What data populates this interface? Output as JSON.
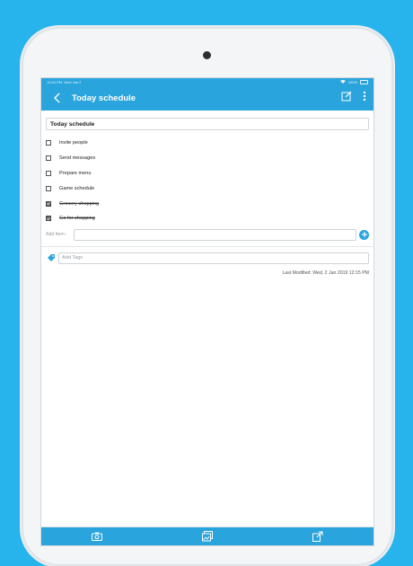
{
  "colors": {
    "background": "#27b3ec",
    "accent": "#2aa4dc",
    "device": "#f4f5f6"
  },
  "statusbar": {
    "time": "12:34 PM",
    "date": "Wed Jan 2",
    "battery": "100%"
  },
  "appbar": {
    "title": "Today schedule",
    "back_icon": "chevron-left-icon",
    "edit_icon": "edit-note-icon",
    "more_icon": "more-vertical-icon"
  },
  "note": {
    "title_value": "Today schedule",
    "items": [
      {
        "label": "Invite people",
        "checked": false
      },
      {
        "label": "Send messages",
        "checked": false
      },
      {
        "label": "Prepare menu",
        "checked": false
      },
      {
        "label": "Game schedule",
        "checked": false
      },
      {
        "label": "Grocery shopping",
        "checked": true
      },
      {
        "label": "Go for shopping",
        "checked": true
      }
    ],
    "add_item_label": "Add Item :",
    "add_button_icon": "plus-icon",
    "tags_placeholder": "Add Tags",
    "tags_icon": "tag-icon",
    "last_modified": "Last Modified: Wed, 2 Jan 2019 12:15 PM"
  },
  "bottombar": {
    "camera_icon": "camera-icon",
    "gallery_icon": "image-gallery-icon",
    "share_icon": "share-icon"
  }
}
